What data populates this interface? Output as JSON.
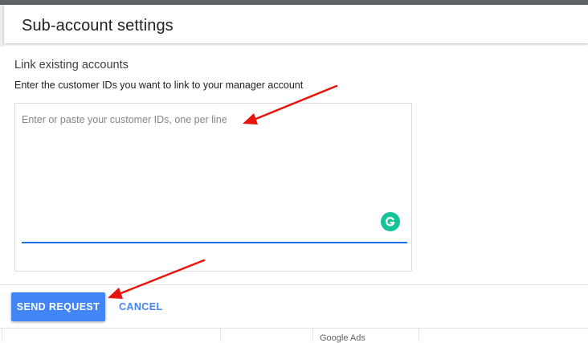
{
  "header": {
    "title": "Sub-account settings"
  },
  "link_section": {
    "title": "Link existing accounts",
    "description": "Enter the customer IDs you want to link to your manager account",
    "ids_input": {
      "value": "",
      "placeholder": "Enter or paste your customer IDs, one per line"
    },
    "extension_icon": "grammarly-icon"
  },
  "actions": {
    "send_label": "SEND REQUEST",
    "cancel_label": "CANCEL"
  },
  "table": {
    "columns": [
      "",
      "",
      "Google Ads",
      ""
    ]
  },
  "colors": {
    "accent": "#4285f4",
    "input_focus": "#1a73e8",
    "annotation_arrow": "#e8140c",
    "grammarly": "#15c39a",
    "topbar": "#5f6368"
  }
}
